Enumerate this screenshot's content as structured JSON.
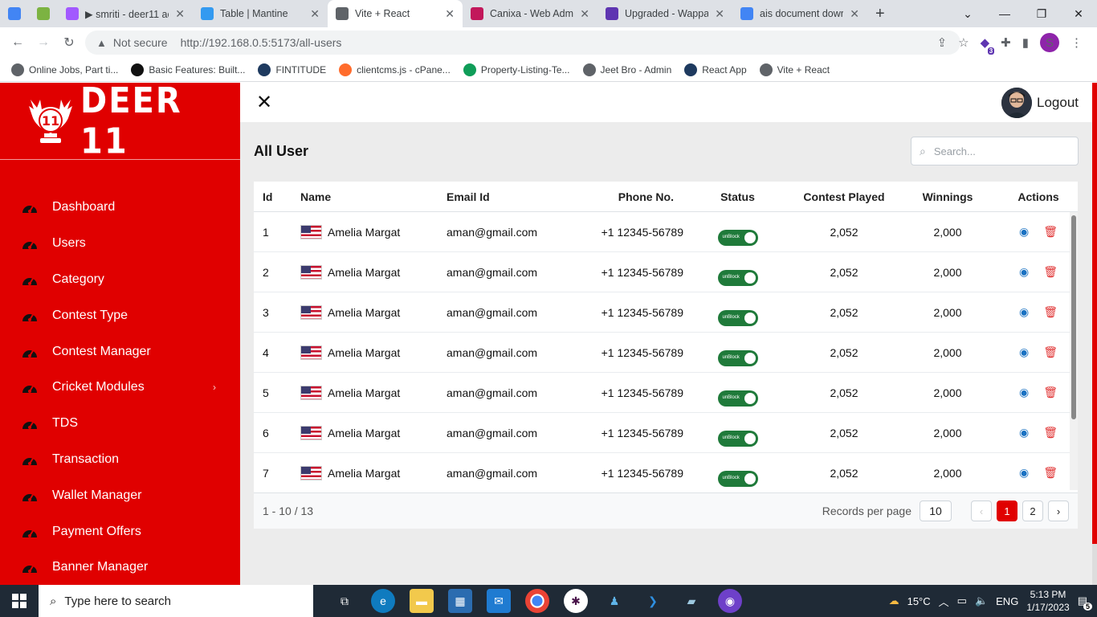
{
  "browser": {
    "tabs": [
      {
        "label": "",
        "color": "#4285f4"
      },
      {
        "label": "",
        "color": "#7cb342"
      },
      {
        "label": "▶ smriti - deer11 ac",
        "color": "#a259ff"
      },
      {
        "label": "Table | Mantine",
        "color": "#339af0"
      },
      {
        "label": "Vite + React",
        "color": "#5f6368",
        "active": true
      },
      {
        "label": "Canixa - Web Admi",
        "color": "#c2185b"
      },
      {
        "label": "Upgraded - Wappal",
        "color": "#5e35b1"
      },
      {
        "label": "ais document dowr",
        "color": "#4285f4"
      }
    ],
    "not_secure": "Not secure",
    "url_host": "http://192.168.0.5",
    "url_path": ":5173/all-users",
    "profile_initial": "S",
    "extension_badge": "3",
    "bookmarks": [
      {
        "label": "Online Jobs, Part ti...",
        "color": "#5f6368"
      },
      {
        "label": "Basic Features: Built...",
        "color": "#111"
      },
      {
        "label": "FINTITUDE",
        "color": "#1e3a5f"
      },
      {
        "label": "clientcms.js - cPane...",
        "color": "#ff6c2c"
      },
      {
        "label": "Property-Listing-Te...",
        "color": "#0f9d58"
      },
      {
        "label": "Jeet Bro - Admin",
        "color": "#5f6368"
      },
      {
        "label": "React App",
        "color": "#1e3a5f"
      },
      {
        "label": "Vite + React",
        "color": "#5f6368"
      }
    ]
  },
  "sidebar": {
    "logo_text": "DEER 11",
    "logo_badge": "11",
    "items": [
      {
        "label": "Dashboard"
      },
      {
        "label": "Users"
      },
      {
        "label": "Category"
      },
      {
        "label": "Contest Type"
      },
      {
        "label": "Contest Manager"
      },
      {
        "label": "Cricket Modules",
        "has_children": true
      },
      {
        "label": "TDS"
      },
      {
        "label": "Transaction"
      },
      {
        "label": "Wallet Manager"
      },
      {
        "label": "Payment Offers"
      },
      {
        "label": "Banner Manager"
      }
    ]
  },
  "header": {
    "logout_label": "Logout"
  },
  "page": {
    "title": "All User",
    "search_placeholder": "Search..."
  },
  "table": {
    "columns": [
      "Id",
      "Name",
      "Email Id",
      "Phone No.",
      "Status",
      "Contest Played",
      "Winnings",
      "Actions"
    ],
    "rows": [
      {
        "id": "1",
        "name": "Amelia Margat",
        "email": "aman@gmail.com",
        "phone": "+1 12345-56789",
        "status": "unBlock",
        "contest": "2,052",
        "winnings": "2,000"
      },
      {
        "id": "2",
        "name": "Amelia Margat",
        "email": "aman@gmail.com",
        "phone": "+1 12345-56789",
        "status": "unBlock",
        "contest": "2,052",
        "winnings": "2,000"
      },
      {
        "id": "3",
        "name": "Amelia Margat",
        "email": "aman@gmail.com",
        "phone": "+1 12345-56789",
        "status": "unBlock",
        "contest": "2,052",
        "winnings": "2,000"
      },
      {
        "id": "4",
        "name": "Amelia Margat",
        "email": "aman@gmail.com",
        "phone": "+1 12345-56789",
        "status": "unBlock",
        "contest": "2,052",
        "winnings": "2,000"
      },
      {
        "id": "5",
        "name": "Amelia Margat",
        "email": "aman@gmail.com",
        "phone": "+1 12345-56789",
        "status": "unBlock",
        "contest": "2,052",
        "winnings": "2,000"
      },
      {
        "id": "6",
        "name": "Amelia Margat",
        "email": "aman@gmail.com",
        "phone": "+1 12345-56789",
        "status": "unBlock",
        "contest": "2,052",
        "winnings": "2,000"
      },
      {
        "id": "7",
        "name": "Amelia Margat",
        "email": "aman@gmail.com",
        "phone": "+1 12345-56789",
        "status": "unBlock",
        "contest": "2,052",
        "winnings": "2,000"
      }
    ],
    "footer": {
      "range": "1 - 10 / 13",
      "records_label": "Records per page",
      "records_value": "10",
      "pages": [
        "1",
        "2"
      ],
      "active_page": "1"
    }
  },
  "taskbar": {
    "search_placeholder": "Type here to search",
    "temperature": "15°C",
    "language": "ENG",
    "time": "5:13 PM",
    "date": "1/17/2023",
    "notifications": "5"
  },
  "colors": {
    "brand": "#e00000",
    "toggle_on": "#1f7a3a",
    "view_icon": "#1971c2",
    "delete_icon": "#e03131"
  }
}
